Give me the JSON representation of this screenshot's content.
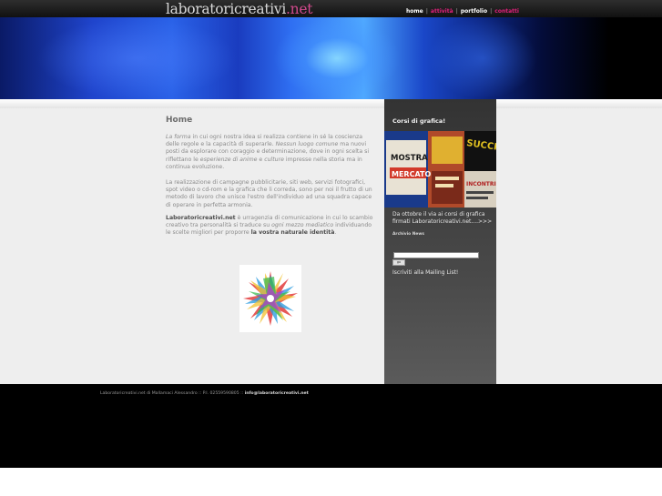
{
  "header": {
    "logo_part1": "laboratori",
    "logo_part2": "creativi",
    "logo_part3": ".net",
    "nav": [
      {
        "label": "home",
        "color": "#ffffff"
      },
      {
        "label": "attività",
        "color": "#e0207a"
      },
      {
        "label": "portfolio",
        "color": "#ffffff"
      },
      {
        "label": "contatti",
        "color": "#e0207a"
      }
    ],
    "nav_separator": "|"
  },
  "main": {
    "title": "Home",
    "p1_em1": "La forma",
    "p1_t1": " in cui ogni nostra idea si realizza contiene in sé la coscienza delle regole e la capacità di superarle. ",
    "p1_em2": "Nessun luogo comune",
    "p1_t2": " ma nuovi posti da esplorare con coraggio e determinazione, dove in ogni scelta si riflettano le ",
    "p1_em3": "esperienze di anime",
    "p1_t3": " e ",
    "p1_em4": "culture",
    "p1_t4": " impresse nella storia ma in continua evoluzione.",
    "p2": "La realizzazione di campagne pubblicitarie, siti web, servizi fotografici, spot video o cd-rom e la grafica che li correda, sono per noi il frutto di un metodo di lavoro che unisce l'estro dell'individuo ad una squadra capace di operare in perfetta armonia.",
    "p3_b1": "Laboratoricreativi.net",
    "p3_t1": " è urragenzia di comunicazione in cui lo scambio creativo tra personalità si traduce su ",
    "p3_em1": "ogni mezzo mediatico",
    "p3_t2": " individuando le scelte migliori per proporre ",
    "p3_b2": "la vostra naturale identità",
    "p3_t3": "."
  },
  "sidebar": {
    "title": "Corsi di grafica!",
    "poster": {
      "mostra": "MOSTRA",
      "mercato": "MERCATO",
      "sucche": "SUCCHE",
      "incontri": "INCONTRI"
    },
    "text": "Da ottobre il via ai corsi di grafica firmati Laboratoricreativi.net....>>>",
    "archive": "Archivio News",
    "input_value": "",
    "button_label": "go",
    "mailing": "Iscriviti alla Mailing List!"
  },
  "footer": {
    "text": "Laboratoricreativi.net di Mallamaci Alessandro :: P.I. 02559590805 :: ",
    "email": "info@laboratoricreativi.net"
  }
}
